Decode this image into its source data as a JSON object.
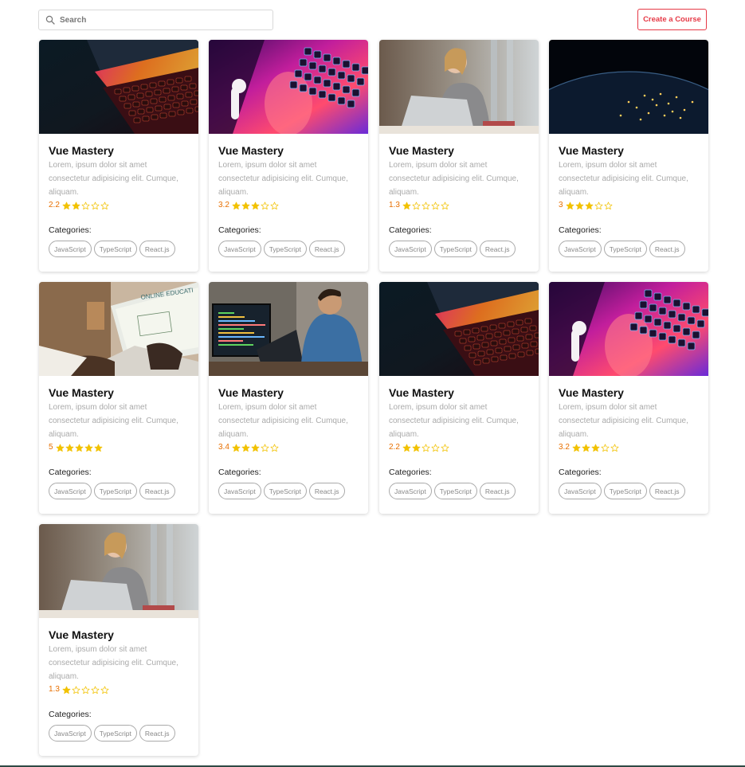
{
  "search": {
    "placeholder": "Search"
  },
  "header": {
    "create_button_label": "Create a Course"
  },
  "labels": {
    "categories": "Categories:"
  },
  "colors": {
    "accent_red": "#e63946",
    "rating_orange": "#e76f00",
    "star_gold": "#f2c200"
  },
  "courses": [
    {
      "title": "Vue Mastery",
      "description": "Lorem, ipsum dolor sit amet consectetur adipisicing elit. Cumque, aliquam.",
      "rating": "2.2",
      "stars_filled": 2,
      "image": "laptop-keyboard-dark",
      "categories": [
        "JavaScript",
        "TypeScript",
        "React.js"
      ]
    },
    {
      "title": "Vue Mastery",
      "description": "Lorem, ipsum dolor sit amet consectetur adipisicing elit. Cumque, aliquam.",
      "rating": "3.2",
      "stars_filled": 3,
      "image": "laptop-neon-earbuds",
      "categories": [
        "JavaScript",
        "TypeScript",
        "React.js"
      ]
    },
    {
      "title": "Vue Mastery",
      "description": "Lorem, ipsum dolor sit amet consectetur adipisicing elit. Cumque, aliquam.",
      "rating": "1.3",
      "stars_filled": 1,
      "image": "woman-with-laptop",
      "categories": [
        "JavaScript",
        "TypeScript",
        "React.js"
      ]
    },
    {
      "title": "Vue Mastery",
      "description": "Lorem, ipsum dolor sit amet consectetur adipisicing elit. Cumque, aliquam.",
      "rating": "3",
      "stars_filled": 3,
      "image": "earth-at-night",
      "categories": [
        "JavaScript",
        "TypeScript",
        "React.js"
      ]
    },
    {
      "title": "Vue Mastery",
      "description": "Lorem, ipsum dolor sit amet consectetur adipisicing elit. Cumque, aliquam.",
      "rating": "5",
      "stars_filled": 5,
      "image": "online-education-laptop",
      "categories": [
        "JavaScript",
        "TypeScript",
        "React.js"
      ]
    },
    {
      "title": "Vue Mastery",
      "description": "Lorem, ipsum dolor sit amet consectetur adipisicing elit. Cumque, aliquam.",
      "rating": "3.4",
      "stars_filled": 3,
      "image": "man-coding",
      "categories": [
        "JavaScript",
        "TypeScript",
        "React.js"
      ]
    },
    {
      "title": "Vue Mastery",
      "description": "Lorem, ipsum dolor sit amet consectetur adipisicing elit. Cumque, aliquam.",
      "rating": "2.2",
      "stars_filled": 2,
      "image": "laptop-keyboard-dark",
      "categories": [
        "JavaScript",
        "TypeScript",
        "React.js"
      ]
    },
    {
      "title": "Vue Mastery",
      "description": "Lorem, ipsum dolor sit amet consectetur adipisicing elit. Cumque, aliquam.",
      "rating": "3.2",
      "stars_filled": 3,
      "image": "laptop-neon-earbuds",
      "categories": [
        "JavaScript",
        "TypeScript",
        "React.js"
      ]
    },
    {
      "title": "Vue Mastery",
      "description": "Lorem, ipsum dolor sit amet consectetur adipisicing elit. Cumque, aliquam.",
      "rating": "1.3",
      "stars_filled": 1,
      "image": "woman-with-laptop",
      "categories": [
        "JavaScript",
        "TypeScript",
        "React.js"
      ]
    }
  ],
  "online_education_text": "ONLINE EDUCATI"
}
